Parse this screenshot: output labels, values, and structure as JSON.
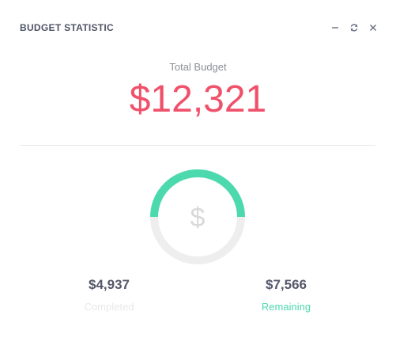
{
  "card": {
    "title": "BUDGET STATISTIC",
    "tools": {
      "minimize_icon": "minus-icon",
      "refresh_icon": "refresh-icon",
      "close_icon": "close-icon"
    }
  },
  "budget": {
    "total_label": "Total Budget",
    "total_value": "$12,321",
    "gauge_symbol": "$",
    "completed_fraction": 0.5,
    "completed_value": "$4,937",
    "completed_label": "Completed",
    "remaining_value": "$7,566",
    "remaining_label": "Remaining"
  },
  "colors": {
    "accent_red": "#f0516a",
    "accent_green": "#4dd9ae",
    "track_gray": "#eeeeee",
    "completed_label": "#e8e8ea",
    "title_text": "#4f5467"
  }
}
